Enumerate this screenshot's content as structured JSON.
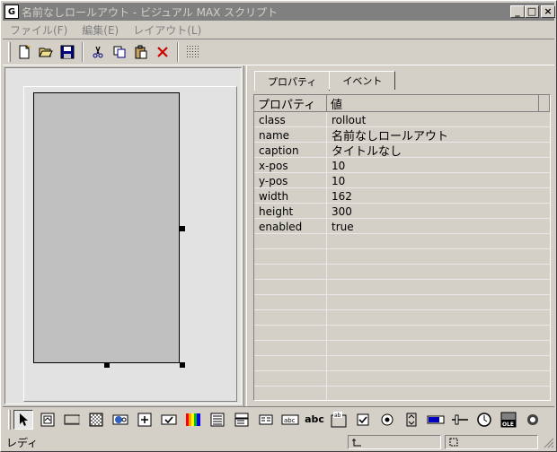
{
  "window": {
    "title": "名前なしロールアウト - ビジュアル MAX スクリプト",
    "app_icon": "maxscript-icon",
    "buttons": [
      "minimize",
      "maximize",
      "close"
    ]
  },
  "menu": [
    "ファイル(F)",
    "編集(E)",
    "レイアウト(L)"
  ],
  "toolbar": [
    "new-icon",
    "open-icon",
    "save-icon",
    "cut-icon",
    "copy-icon",
    "paste-icon",
    "delete-icon",
    "grid-icon"
  ],
  "tabs": [
    "プロパティ",
    "イベント"
  ],
  "grid": {
    "headers": [
      "プロパティ",
      "値"
    ],
    "rows": [
      {
        "prop": "class",
        "value": "rollout"
      },
      {
        "prop": "name",
        "value": "名前なしロールアウト"
      },
      {
        "prop": "caption",
        "value": "タイトルなし"
      },
      {
        "prop": "x-pos",
        "value": "10"
      },
      {
        "prop": "y-pos",
        "value": "10"
      },
      {
        "prop": "width",
        "value": "162"
      },
      {
        "prop": "height",
        "value": "300"
      },
      {
        "prop": "enabled",
        "value": "true"
      }
    ]
  },
  "controls": {
    "edittext_label": "abc",
    "label_label": "abc",
    "groupbox_label": "ab",
    "activex_label": "OLE"
  },
  "status": {
    "text": "レディ"
  },
  "colors": {
    "titlebar_inactive": "#808080",
    "accent_red": "#cc0000"
  }
}
